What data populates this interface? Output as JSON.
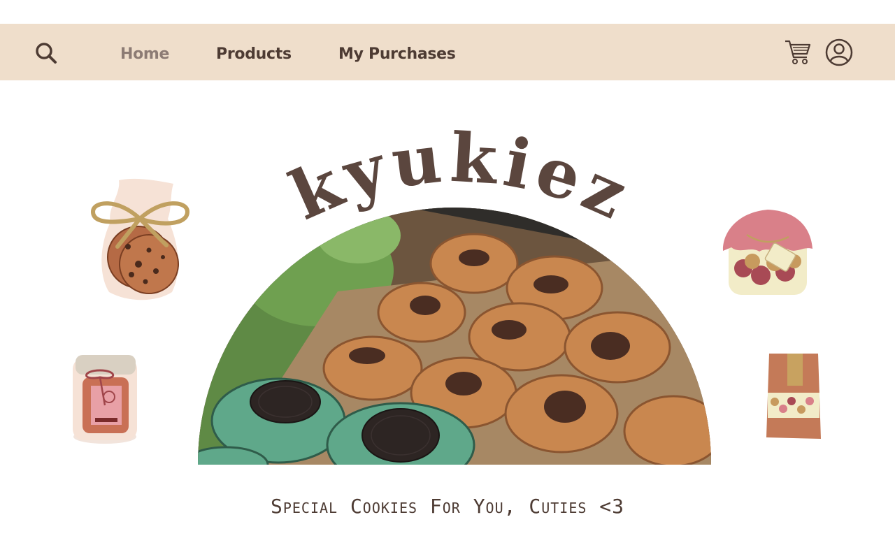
{
  "nav": {
    "search_icon": "search-icon",
    "links": [
      {
        "label": "Home",
        "active": true
      },
      {
        "label": "Products",
        "active": false
      },
      {
        "label": "My Purchases",
        "active": false
      }
    ],
    "cart_icon": "cart-icon",
    "account_icon": "user-circle-icon"
  },
  "brand": {
    "name": "kyukiez"
  },
  "hero": {
    "image": "photo of chocolate chip and mint oreo cookies on a baking tray"
  },
  "decorations": [
    "cookie-bag-illustration",
    "cookie-tin-illustration",
    "jam-jar-illustration",
    "snack-pouch-illustration"
  ],
  "tagline": "Special Cookies For You, Cuties <3",
  "colors": {
    "navbar_bg": "#efdecb",
    "text_dark": "#4d3b33",
    "text_muted": "#8c7b74",
    "brand": "#5b463e"
  }
}
